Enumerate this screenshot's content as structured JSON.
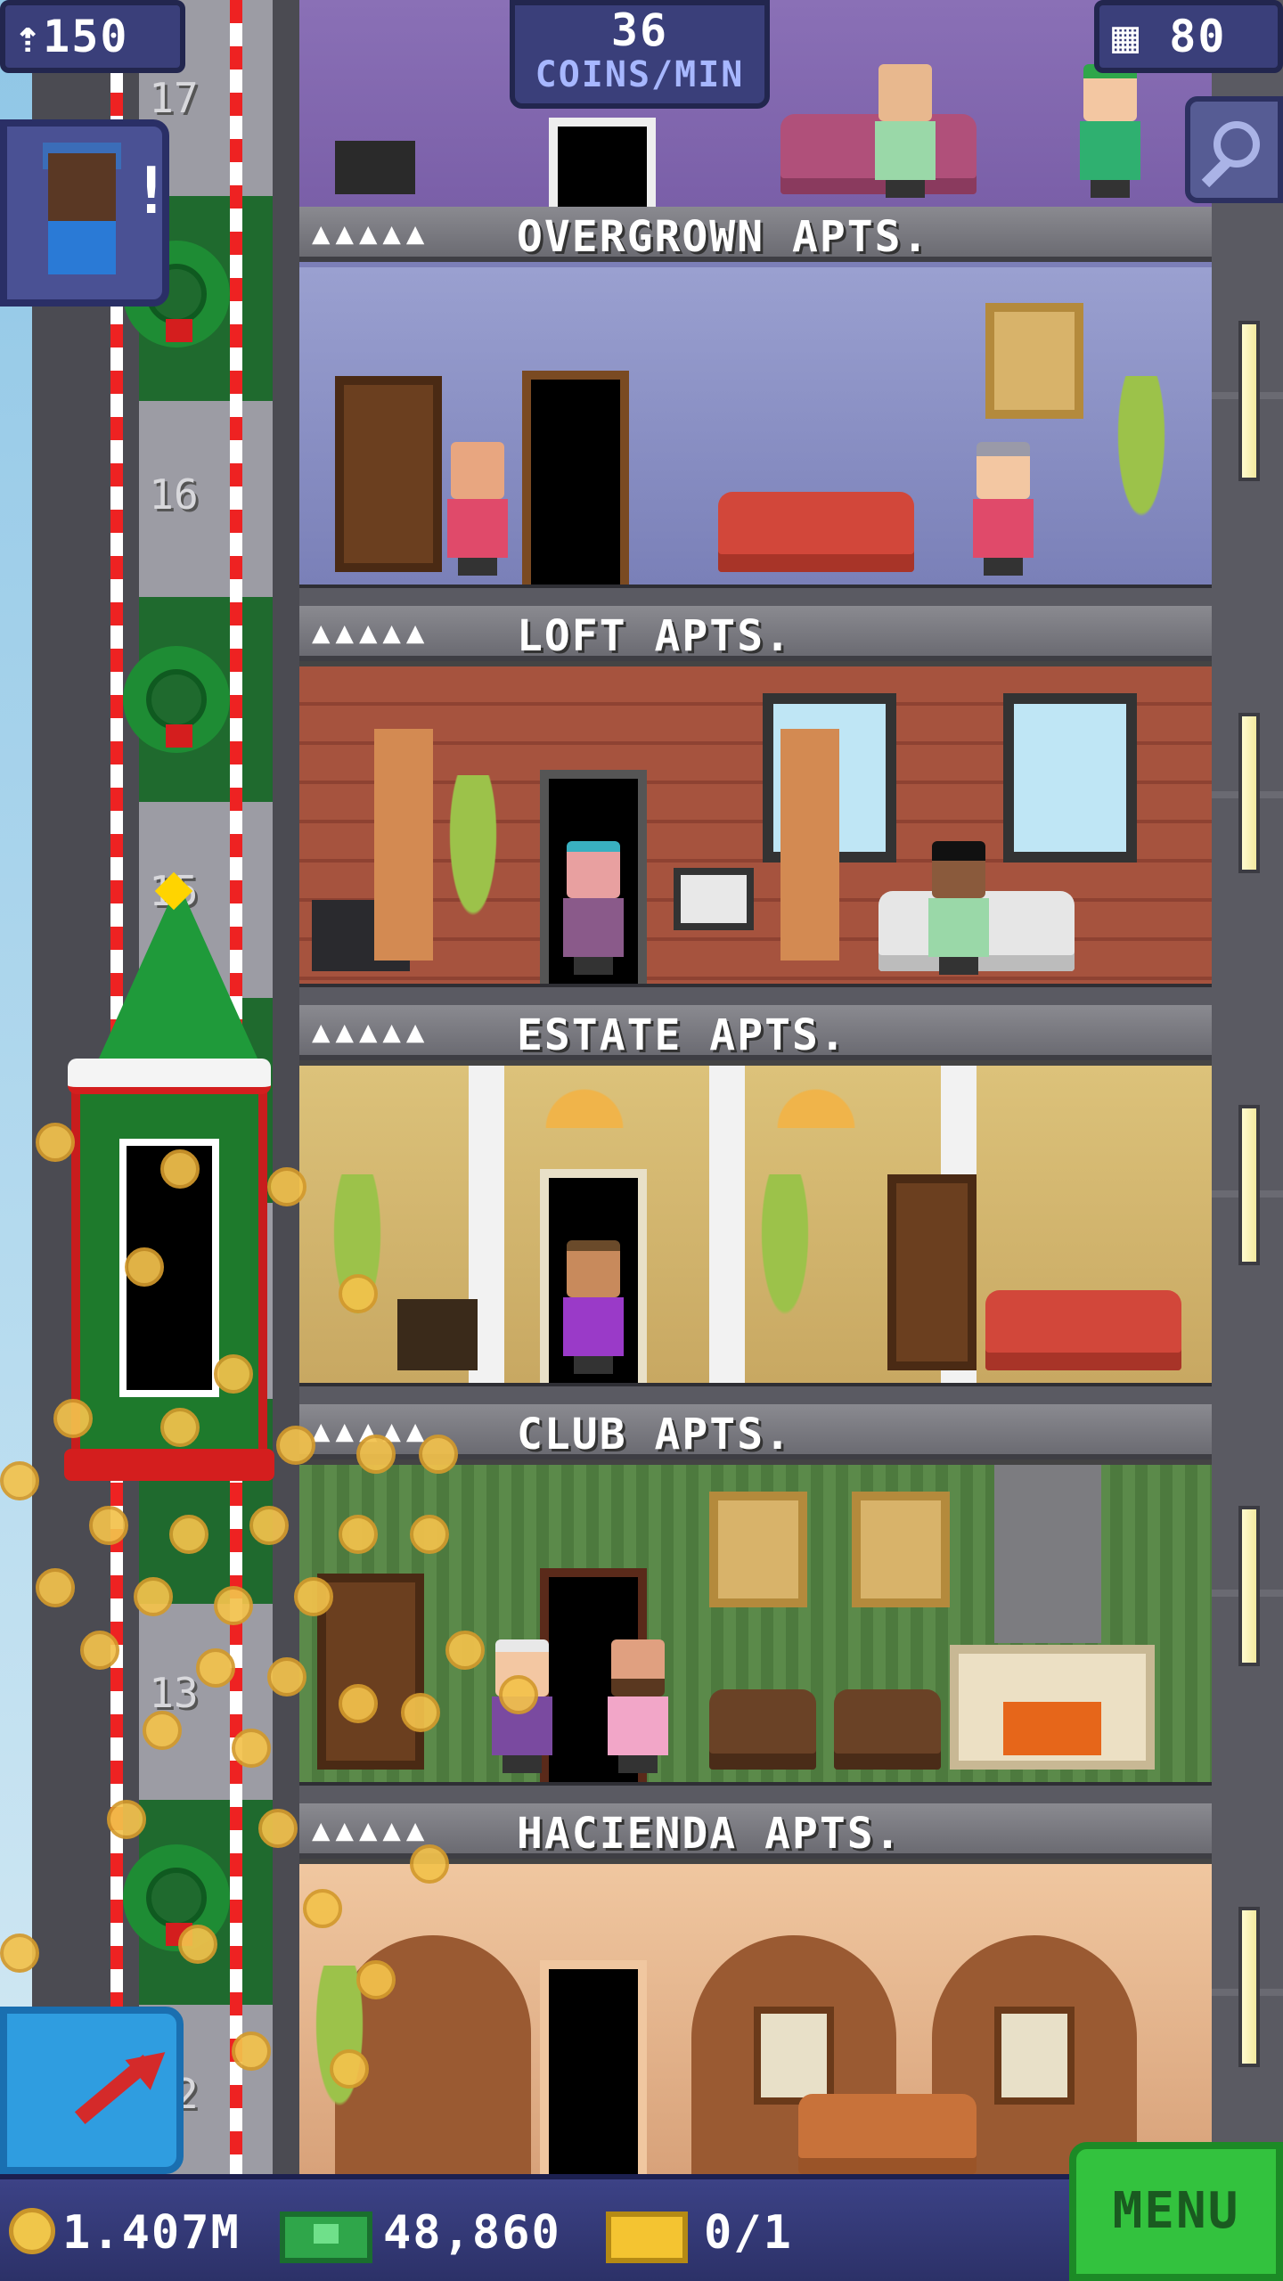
{
  "hud": {
    "population": "150",
    "coins_rate_value": "36",
    "coins_rate_unit": "COINS/MIN",
    "floors": "80"
  },
  "floors": [
    {
      "stars": "▲▲▲▲▲",
      "name": "OVERGROWN APTS."
    },
    {
      "stars": "▲▲▲▲▲",
      "name": "LOFT APTS."
    },
    {
      "stars": "▲▲▲▲▲",
      "name": "ESTATE APTS."
    },
    {
      "stars": "▲▲▲▲▲",
      "name": "CLUB APTS."
    },
    {
      "stars": "▲▲▲▲▲",
      "name": "HACIENDA APTS."
    }
  ],
  "elevator": {
    "floor_numbers": [
      "17",
      "16",
      "15",
      "13",
      "12"
    ]
  },
  "bottom_bar": {
    "coins": "1.407M",
    "bux": "48,860",
    "tickets": "0/1",
    "menu_label": "MENU"
  },
  "visitor": {
    "alert": "!"
  },
  "colors": {
    "hud_bg": "#3a3f7a",
    "menu_green": "#33c23e",
    "coin_gold": "#f3c24c",
    "elevator_red": "#c81d1d"
  },
  "icons": {
    "population": "person-up-icon",
    "floors": "building-grid-icon",
    "search": "magnifier-icon",
    "coins": "coin-icon",
    "bux": "bux-bill-icon",
    "tickets": "golden-ticket-icon",
    "vip": "red-arrow-icon"
  }
}
